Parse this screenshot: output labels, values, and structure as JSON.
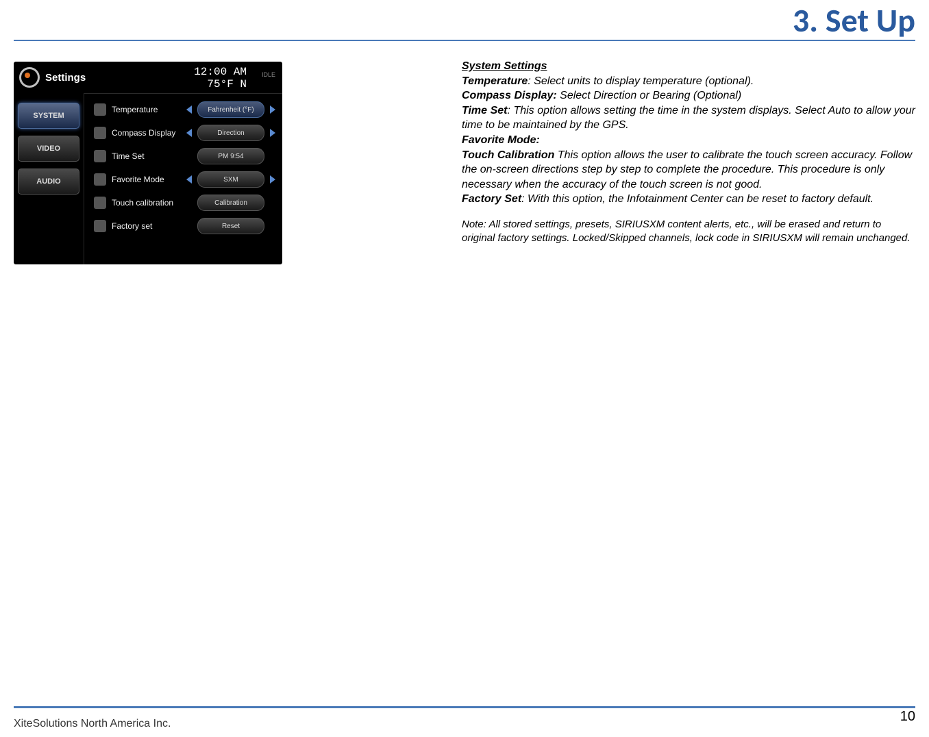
{
  "page": {
    "title": "3. Set Up",
    "footer_left": "XiteSolutions North America Inc.",
    "page_number": "10"
  },
  "screenshot": {
    "title": "Settings",
    "clock_time": "12:00 AM",
    "clock_temp": "75°F  N",
    "idle": "IDLE",
    "sidebar": [
      "SYSTEM",
      "VIDEO",
      "AUDIO"
    ],
    "rows": [
      {
        "label": "Temperature",
        "value": "Fahrenheit (°F)",
        "arrows": true,
        "sel": true
      },
      {
        "label": "Compass Display",
        "value": "Direction",
        "arrows": true,
        "sel": false
      },
      {
        "label": "Time Set",
        "value": "PM 9:54",
        "arrows": false,
        "sel": false
      },
      {
        "label": "Favorite Mode",
        "value": "SXM",
        "arrows": true,
        "sel": false
      },
      {
        "label": "Touch calibration",
        "value": "Calibration",
        "arrows": false,
        "sel": false
      },
      {
        "label": "Factory set",
        "value": "Reset",
        "arrows": false,
        "sel": false
      }
    ]
  },
  "text": {
    "heading": "System Settings",
    "t_temp_l": "Temperature",
    "t_temp_b": ": Select units to display temperature (optional).",
    "t_comp_l": "Compass Display:",
    "t_comp_b": " Select Direction or Bearing (Optional)",
    "t_time_l": "Time Set",
    "t_time_b": ": This option allows setting the time in the system displays. Select Auto to allow your time to be maintained by the GPS.",
    "t_fav_l": "Favorite Mode:",
    "t_touch_l": "Touch Calibration",
    "t_touch_b": " This option allows the user to calibrate the touch screen accuracy. Follow the on-screen directions step by step to complete the procedure. This procedure is only necessary when the accuracy of the touch screen is not good.",
    "t_fact_l": "Factory Set",
    "t_fact_b": ": With this option, the Infotainment Center can be reset to factory default.",
    "note": "Note: All stored settings, presets, SIRIUSXM content alerts, etc., will be erased and return to original factory settings. Locked/Skipped channels, lock code in SIRIUSXM will remain unchanged."
  }
}
